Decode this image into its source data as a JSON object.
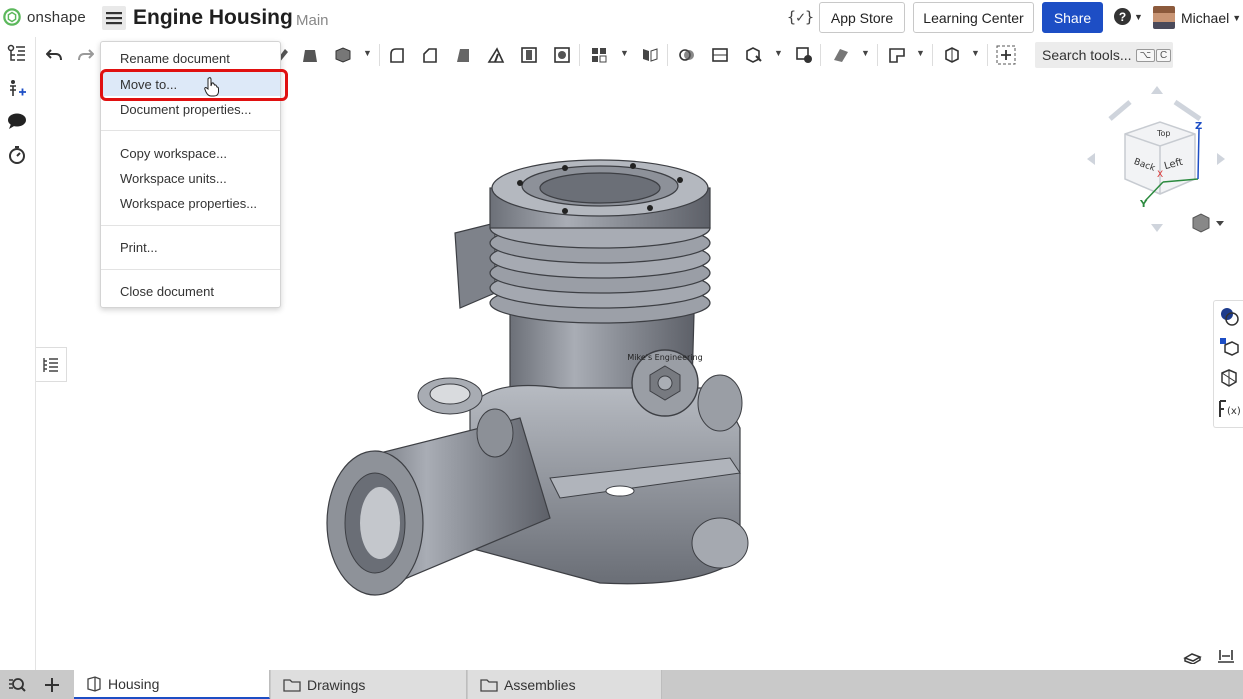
{
  "app": {
    "logo_text": "onshape",
    "brand_color": "#5cb85c"
  },
  "header": {
    "document_title": "Engine Housing",
    "branch": "Main",
    "variables_button": "{✓}",
    "app_store": "App Store",
    "learning_center": "Learning Center",
    "share": "Share",
    "user_name": "Michael",
    "help_glyph": "?",
    "share_color": "#1d4ec5"
  },
  "toolbar": {
    "search_label": "Search tools...",
    "shortcut_key1": "⌥",
    "shortcut_key2": "C"
  },
  "menu": {
    "items": [
      {
        "label": "Rename document"
      },
      {
        "label": "Move to..."
      },
      {
        "label": "Document properties..."
      },
      {
        "label": "Copy workspace..."
      },
      {
        "label": "Workspace units..."
      },
      {
        "label": "Workspace properties..."
      },
      {
        "label": "Print..."
      },
      {
        "label": "Close document"
      }
    ],
    "highlighted": "Move to...",
    "highlight_box_color": "#e01010"
  },
  "viewcube": {
    "labels": {
      "top": "Top",
      "back": "Back",
      "left": "Left",
      "x": "X",
      "y": "Y",
      "z": "Z"
    }
  },
  "model": {
    "engraving": "Mike's Engineering"
  },
  "tabs": [
    {
      "label": "Housing",
      "active": true,
      "icon": "part-studio-icon"
    },
    {
      "label": "Drawings",
      "active": false,
      "icon": "folder-icon"
    },
    {
      "label": "Assemblies",
      "active": false,
      "icon": "folder-icon"
    }
  ]
}
